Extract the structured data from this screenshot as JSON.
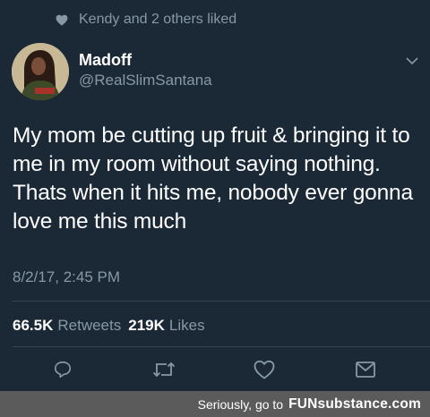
{
  "social_context": {
    "text": "Kendy and 2 others liked",
    "icon": "heart-icon"
  },
  "author": {
    "name": "Madoff",
    "handle": "@RealSlimSantana"
  },
  "tweet": {
    "text": "My mom be cutting up fruit & bringing it to me in my room without saying nothing. Thats when it hits me, nobody ever gonna love me this much",
    "timestamp": "8/2/17, 2:45 PM"
  },
  "stats": {
    "retweets_count": "66.5K",
    "retweets_label": "Retweets",
    "likes_count": "219K",
    "likes_label": "Likes"
  },
  "actions": [
    "reply-icon",
    "retweet-icon",
    "like-icon",
    "message-icon"
  ],
  "footer": {
    "text": "Seriously, go to",
    "brand": "FUNsubstance.com"
  },
  "colors": {
    "background": "#1b2836",
    "secondary_text": "#8899a6",
    "divider": "#38444d",
    "footer_bg": "#5b5b5b"
  }
}
